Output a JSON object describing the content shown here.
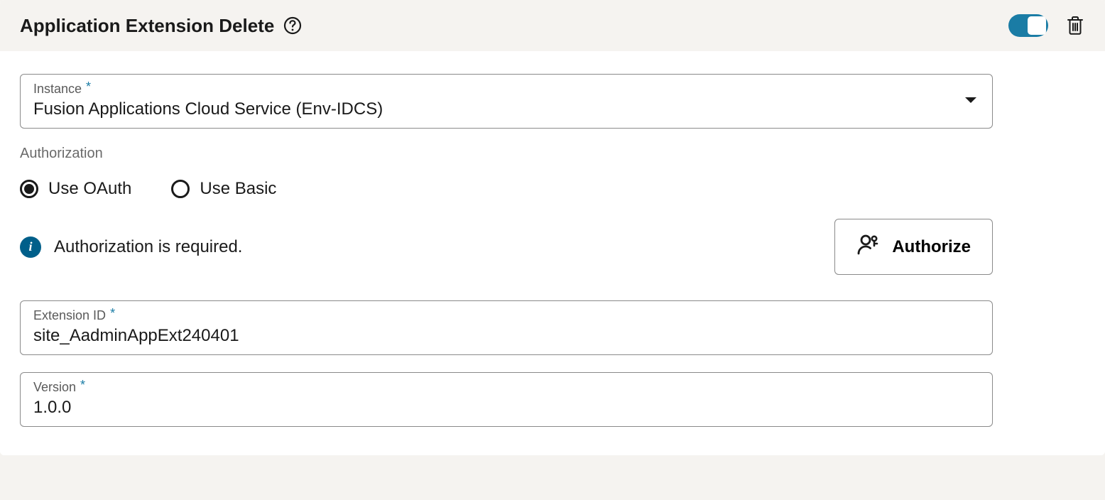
{
  "header": {
    "title": "Application Extension Delete",
    "toggle_on": true
  },
  "instance": {
    "label": "Instance",
    "value": "Fusion Applications Cloud Service (Env-IDCS)"
  },
  "authorization": {
    "heading": "Authorization",
    "options": {
      "oauth": "Use OAuth",
      "basic": "Use Basic"
    },
    "selected": "oauth",
    "info_text": "Authorization is required.",
    "authorize_button": "Authorize"
  },
  "extension_id": {
    "label": "Extension ID",
    "value": "site_AadminAppExt240401"
  },
  "version": {
    "label": "Version",
    "value": "1.0.0"
  }
}
